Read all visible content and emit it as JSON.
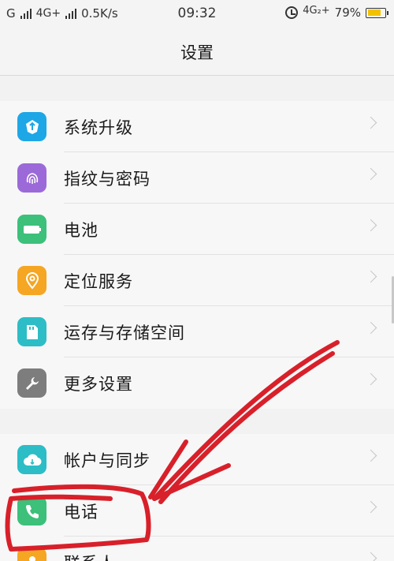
{
  "status_bar": {
    "carrier1": "G",
    "carrier2": "4G+",
    "speed": "0.5K/s",
    "time": "09:32",
    "network": "4G₂+",
    "battery_percent": "79%",
    "battery_level": 0.79
  },
  "header": {
    "title": "设置"
  },
  "groups": [
    {
      "items": [
        {
          "label": "系统升级",
          "icon": "system-upgrade-icon",
          "color": "#1da7e6"
        },
        {
          "label": "指纹与密码",
          "icon": "fingerprint-icon",
          "color": "#9b6ad8"
        },
        {
          "label": "电池",
          "icon": "battery-icon",
          "color": "#3cc07a"
        },
        {
          "label": "定位服务",
          "icon": "location-icon",
          "color": "#f5a623"
        },
        {
          "label": "运存与存储空间",
          "icon": "storage-icon",
          "color": "#2dbdc6"
        },
        {
          "label": "更多设置",
          "icon": "wrench-icon",
          "color": "#7d7d7d"
        }
      ]
    },
    {
      "items": [
        {
          "label": "帐户与同步",
          "icon": "cloud-sync-icon",
          "color": "#2dbdc6"
        },
        {
          "label": "电话",
          "icon": "phone-icon",
          "color": "#3cc07a"
        },
        {
          "label": "联系人",
          "icon": "contacts-icon",
          "color": "#f5a623"
        }
      ]
    }
  ],
  "annotation_color": "#d8202a"
}
